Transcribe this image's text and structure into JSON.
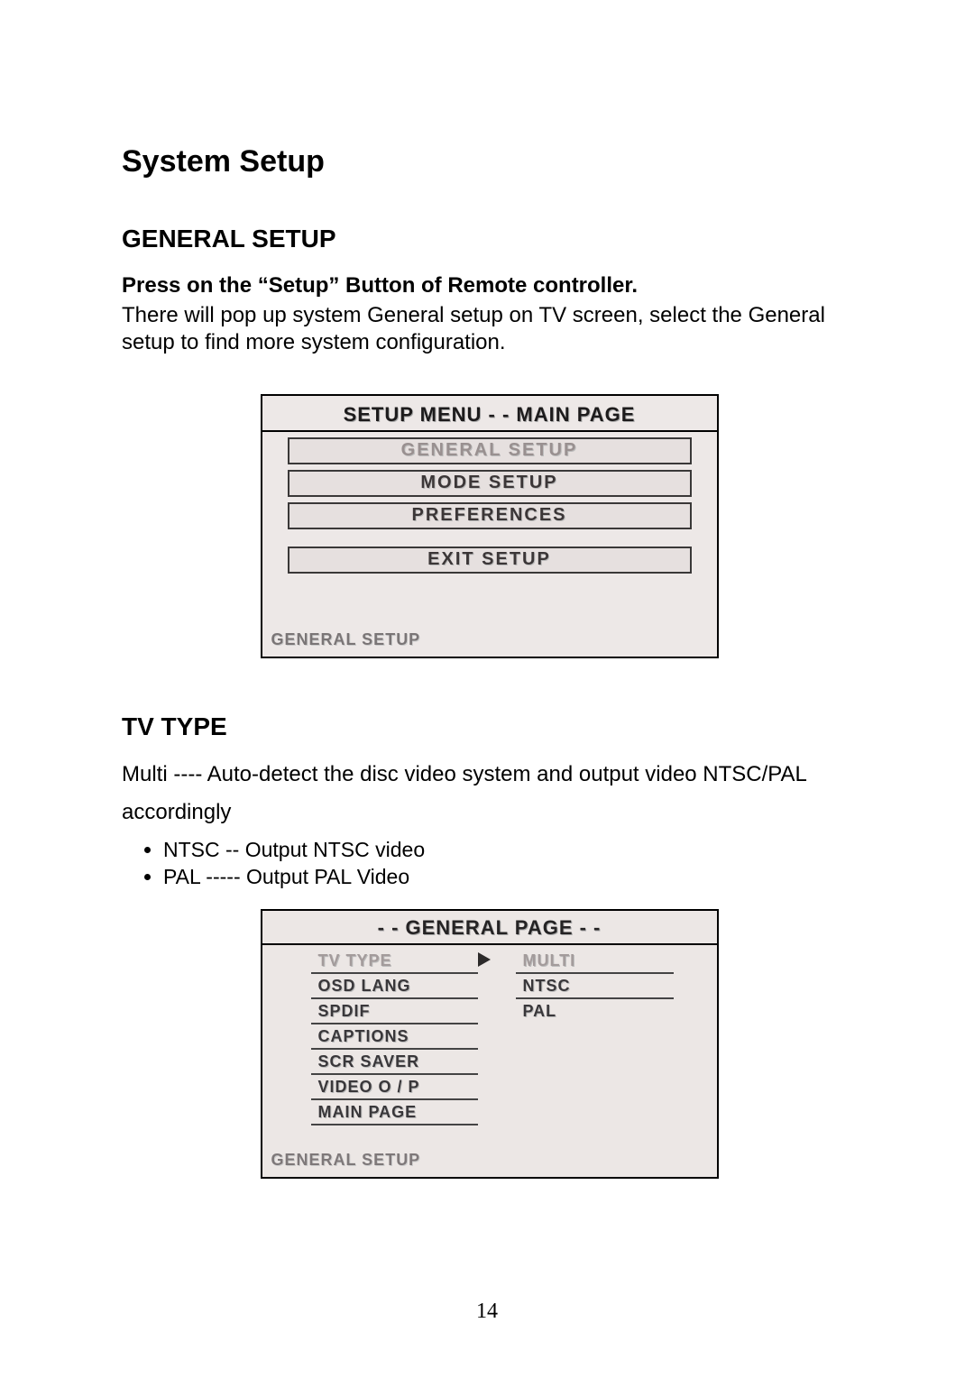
{
  "title": "System Setup",
  "section1": {
    "heading": "GENERAL SETUP",
    "bold_line": "Press on the “Setup” Button of Remote controller.",
    "body_line": "There will pop up system General setup on TV screen, select the General setup to find more system configuration."
  },
  "osd1": {
    "title": "SETUP MENU   - -   MAIN  PAGE",
    "items": [
      {
        "label": "GENERAL  SETUP",
        "highlight": true
      },
      {
        "label": "MODE  SETUP",
        "highlight": false
      },
      {
        "label": "PREFERENCES",
        "highlight": false
      }
    ],
    "exit_label": "EXIT  SETUP",
    "breadcrumb": "GENERAL SETUP"
  },
  "section2": {
    "heading": "TV TYPE",
    "multi_desc": "Multi ---- Auto-detect the disc video system and output video NTSC/PAL",
    "accordingly": "accordingly",
    "bullets": [
      "NTSC -- Output NTSC video",
      "PAL ----- Output PAL Video"
    ]
  },
  "osd2": {
    "title": "- -   GENERAL  PAGE   - -",
    "left_items": [
      {
        "label": "TV TYPE",
        "highlight": true
      },
      {
        "label": "OSD LANG",
        "highlight": false
      },
      {
        "label": "SPDIF",
        "highlight": false
      },
      {
        "label": "CAPTIONS",
        "highlight": false
      },
      {
        "label": "SCR SAVER",
        "highlight": false
      },
      {
        "label": "VIDEO O / P",
        "highlight": false
      },
      {
        "label": "MAIN PAGE",
        "highlight": false
      }
    ],
    "right_items": [
      {
        "label": "MULTI",
        "highlight": true
      },
      {
        "label": "NTSC",
        "highlight": false
      },
      {
        "label": "PAL",
        "highlight": false
      }
    ],
    "breadcrumb": "GENERAL SETUP"
  },
  "page_number": "14"
}
